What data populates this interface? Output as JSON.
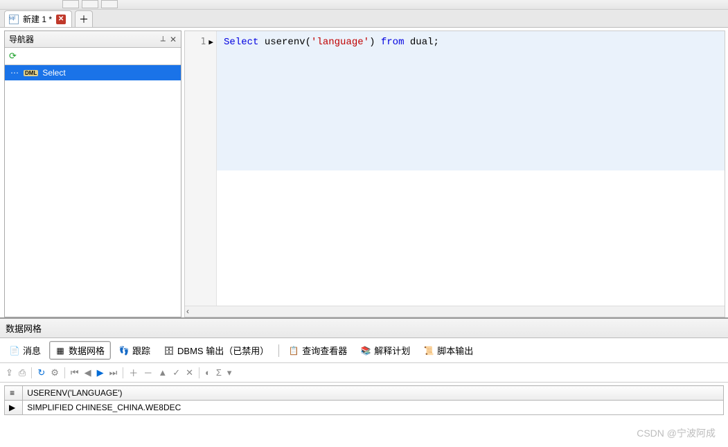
{
  "tab": {
    "title": "新建 1 *",
    "close_symbol": "✕",
    "add_symbol": "＋"
  },
  "navigator": {
    "title": "导航器",
    "pin_icon": "📌",
    "close_icon": "✕",
    "refresh_icon": "⟳",
    "item": {
      "prefix": "⋯",
      "tag": "DML",
      "label": "Select"
    }
  },
  "editor": {
    "line_number": "1",
    "run_marker": "▶",
    "code": {
      "kw_select": "Select",
      "fn": "userenv",
      "paren_open": "(",
      "str": "'language'",
      "paren_close": ")",
      "kw_from": "from",
      "tbl": "dual",
      "semi": ";"
    },
    "scroll_left": "‹"
  },
  "bottom": {
    "panel_title": "数据网格",
    "tabs": {
      "messages": "消息",
      "grid": "数据网格",
      "trace": "跟踪",
      "dbms": "DBMS 输出（已禁用）",
      "query_viewer": "查询查看器",
      "explain": "解释计划",
      "script_out": "脚本输出"
    },
    "toolbar": {
      "sigma": "Σ",
      "dash": "–"
    },
    "result": {
      "row_indicator_header": "≡",
      "row_indicator": "▶",
      "col1_header": "USERENV('LANGUAGE')",
      "col1_value": "SIMPLIFIED CHINESE_CHINA.WE8DEC"
    }
  },
  "watermark": "CSDN @宁波阿成"
}
